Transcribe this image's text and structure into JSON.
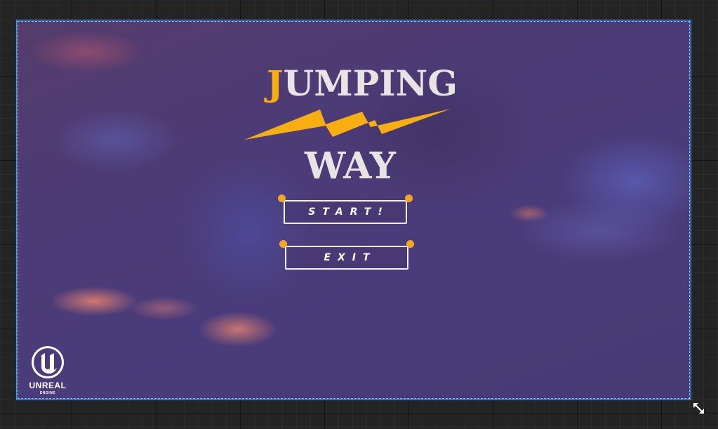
{
  "game": {
    "title_first_letter": "J",
    "title_rest": "UMPING",
    "title_second_line": "WAY"
  },
  "menu": {
    "start_label": "START!",
    "exit_label": "EXIT"
  },
  "engine_logo": {
    "name": "UNREAL",
    "subtitle": "ENGINE"
  },
  "colors": {
    "accent": "#f7ae10",
    "button_border": "#f2f0f4",
    "selection_outline": "#27a9ff",
    "background": "#4a3c7a"
  },
  "icons": {
    "title_emblem": "lightning-bolt-icon",
    "engine_emblem": "unreal-engine-logo-icon",
    "resize": "resize-diagonal-icon"
  }
}
